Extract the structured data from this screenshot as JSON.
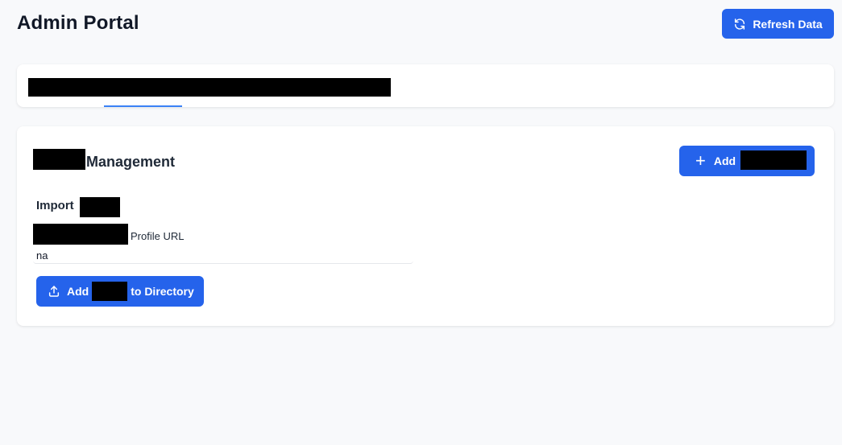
{
  "header": {
    "title": "Admin Portal",
    "refresh_label": "Refresh Data"
  },
  "management": {
    "heading": "Management",
    "add_label": "Add",
    "import_label": "Import",
    "url_label": "Profile URL",
    "url_value": "na",
    "add_dir_label_prefix": "Add",
    "add_dir_label_suffix": "to Directory"
  },
  "colors": {
    "primary": "#2563eb",
    "background": "#f8f9fb",
    "tab_underline": "#3b82f6"
  },
  "icons": {
    "refresh": "refresh-icon",
    "plus": "plus-icon",
    "upload": "upload-icon"
  }
}
